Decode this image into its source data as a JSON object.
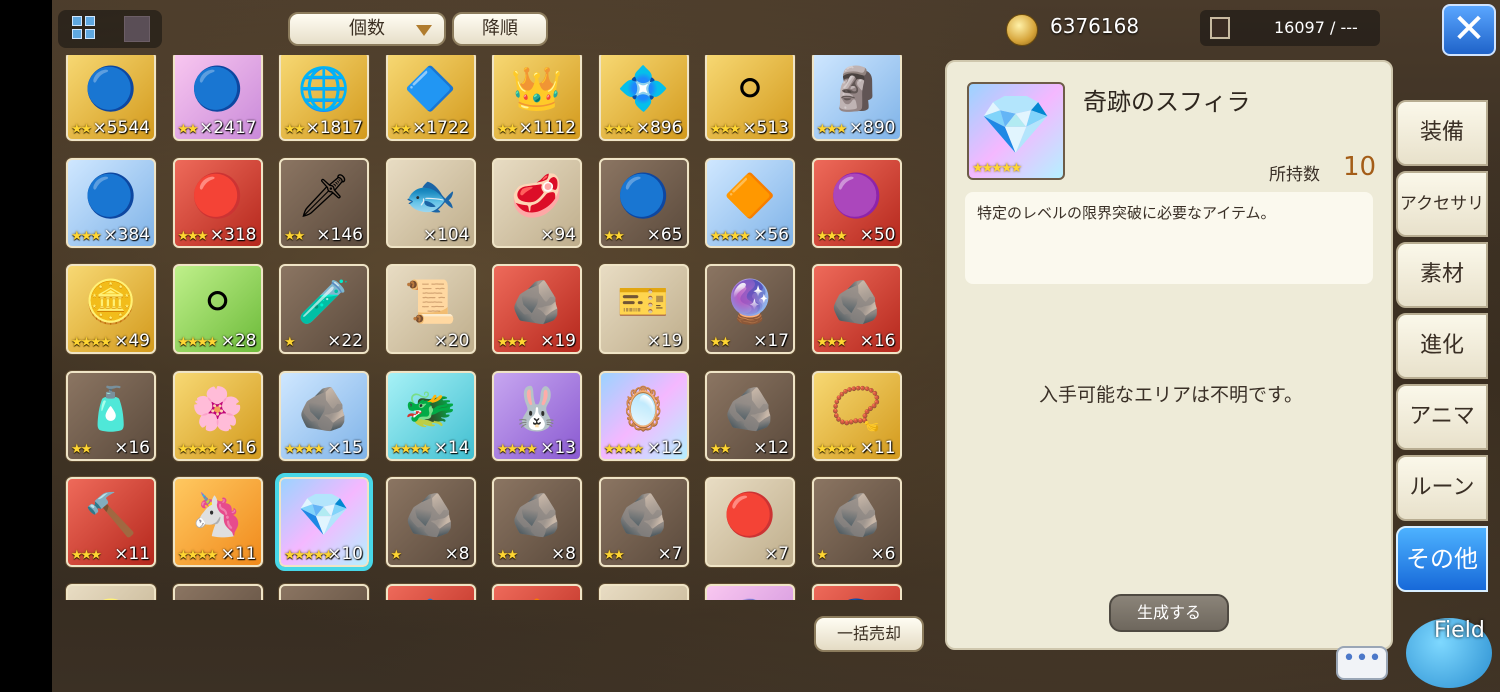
{
  "toolbar": {
    "grid_view_icon": "grid-icon",
    "list_view_icon": "list-icon",
    "sort_key": "個数",
    "sort_order": "降順"
  },
  "currency": {
    "coins": "6376168",
    "capacity": "16097 / ---"
  },
  "items": [
    {
      "art": "🔵",
      "bg": "gold",
      "stars": "★★",
      "qty": "×5544"
    },
    {
      "art": "🔵",
      "bg": "pink",
      "stars": "★★",
      "qty": "×2417"
    },
    {
      "art": "🌐",
      "bg": "gold",
      "stars": "★★",
      "qty": "×1817"
    },
    {
      "art": "🔷",
      "bg": "gold",
      "stars": "★★",
      "qty": "×1722"
    },
    {
      "art": "👑",
      "bg": "gold",
      "stars": "★★",
      "qty": "×1112"
    },
    {
      "art": "💠",
      "bg": "gold",
      "stars": "★★★",
      "qty": "×896"
    },
    {
      "art": "⚪",
      "bg": "gold",
      "stars": "★★★",
      "qty": "×513"
    },
    {
      "art": "🗿",
      "bg": "blue",
      "stars": "★★★",
      "qty": "×890"
    },
    {
      "art": "🔵",
      "bg": "blue",
      "stars": "★★★",
      "qty": "×384"
    },
    {
      "art": "🔴",
      "bg": "red",
      "stars": "★★★",
      "qty": "×318"
    },
    {
      "art": "🗡",
      "bg": "brown",
      "stars": "★★",
      "qty": "×146"
    },
    {
      "art": "🐟",
      "bg": "tan",
      "stars": "",
      "qty": "×104"
    },
    {
      "art": "🥩",
      "bg": "tan",
      "stars": "",
      "qty": "×94"
    },
    {
      "art": "🔵",
      "bg": "brown",
      "stars": "★★",
      "qty": "×65"
    },
    {
      "art": "🔶",
      "bg": "blue",
      "stars": "★★★★",
      "qty": "×56"
    },
    {
      "art": "🟣",
      "bg": "red",
      "stars": "★★★",
      "qty": "×50"
    },
    {
      "art": "🪙",
      "bg": "gold",
      "stars": "★★★★",
      "qty": "×49"
    },
    {
      "art": "⚪",
      "bg": "green",
      "stars": "★★★★",
      "qty": "×28"
    },
    {
      "art": "🧪",
      "bg": "brown",
      "stars": "★",
      "qty": "×22"
    },
    {
      "art": "📜",
      "bg": "tan",
      "stars": "",
      "qty": "×20"
    },
    {
      "art": "🪨",
      "bg": "red",
      "stars": "★★★",
      "qty": "×19"
    },
    {
      "art": "🎫",
      "bg": "tan",
      "stars": "",
      "qty": "×19"
    },
    {
      "art": "🔮",
      "bg": "brown",
      "stars": "★★",
      "qty": "×17"
    },
    {
      "art": "🪨",
      "bg": "red",
      "stars": "★★★",
      "qty": "×16"
    },
    {
      "art": "🧴",
      "bg": "brown",
      "stars": "★★",
      "qty": "×16"
    },
    {
      "art": "🌸",
      "bg": "gold",
      "stars": "★★★★",
      "qty": "×16"
    },
    {
      "art": "🪨",
      "bg": "blue",
      "stars": "★★★★",
      "qty": "×15"
    },
    {
      "art": "🐲",
      "bg": "cyan",
      "stars": "★★★★",
      "qty": "×14"
    },
    {
      "art": "🐰",
      "bg": "purple",
      "stars": "★★★★",
      "qty": "×13"
    },
    {
      "art": "🪞",
      "bg": "rainbow",
      "stars": "★★★★",
      "qty": "×12"
    },
    {
      "art": "🪨",
      "bg": "brown",
      "stars": "★★",
      "qty": "×12"
    },
    {
      "art": "📿",
      "bg": "gold",
      "stars": "★★★★",
      "qty": "×11"
    },
    {
      "art": "🔨",
      "bg": "red",
      "stars": "★★★",
      "qty": "×11"
    },
    {
      "art": "🦄",
      "bg": "orange",
      "stars": "★★★★",
      "qty": "×11"
    },
    {
      "art": "💎",
      "bg": "rainbow",
      "stars": "★★★★★",
      "qty": "×10",
      "selected": true
    },
    {
      "art": "🪨",
      "bg": "brown",
      "stars": "★",
      "qty": "×8"
    },
    {
      "art": "🪨",
      "bg": "brown",
      "stars": "★★",
      "qty": "×8"
    },
    {
      "art": "🪨",
      "bg": "brown",
      "stars": "★★",
      "qty": "×7"
    },
    {
      "art": "🔴",
      "bg": "tan",
      "stars": "",
      "qty": "×7"
    },
    {
      "art": "🪨",
      "bg": "brown",
      "stars": "★",
      "qty": "×6"
    },
    {
      "art": "🪙",
      "bg": "tan",
      "stars": "",
      "qty": ""
    },
    {
      "art": "⚪",
      "bg": "brown",
      "stars": "",
      "qty": ""
    },
    {
      "art": "⚪",
      "bg": "brown",
      "stars": "",
      "qty": ""
    },
    {
      "art": "🔷",
      "bg": "red",
      "stars": "",
      "qty": ""
    },
    {
      "art": "🔶",
      "bg": "red",
      "stars": "",
      "qty": ""
    },
    {
      "art": "🗡",
      "bg": "tan",
      "stars": "",
      "qty": ""
    },
    {
      "art": "🔮",
      "bg": "pink",
      "stars": "",
      "qty": ""
    },
    {
      "art": "🔵",
      "bg": "red",
      "stars": "",
      "qty": ""
    }
  ],
  "bulk_sell_label": "一括売却",
  "detail": {
    "name": "奇跡のスフィラ",
    "stars": "★★★★★",
    "owned_label": "所持数",
    "owned_value": "10",
    "description": "特定のレベルの限界突破に必要なアイテム。",
    "area_text": "入手可能なエリアは不明です。",
    "generate_label": "生成する"
  },
  "tabs": [
    "装備",
    "アクセサリ",
    "素材",
    "進化",
    "アニマ",
    "ルーン",
    "その他"
  ],
  "active_tab": "その他",
  "chat_label": "•••",
  "mascot_label": "Field",
  "colors": {
    "accent_blue": "#1f63c9",
    "selection_cyan": "#47d7e8",
    "star_gold": "#ffd633",
    "owned_count": "#a45d18"
  }
}
